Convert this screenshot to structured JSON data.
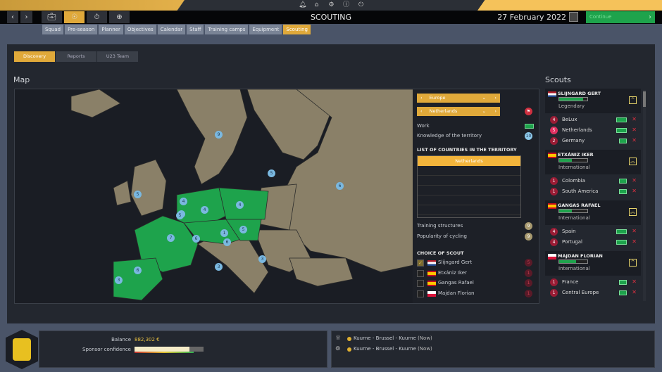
{
  "topbar": {
    "icons": [
      "bell-icon",
      "home-icon",
      "gear-icon",
      "info-icon",
      "power-icon"
    ]
  },
  "nav": {
    "title": "SCOUTING",
    "date": "27 February 2022",
    "continue_label": "Continue"
  },
  "subtabs": [
    "Squad",
    "Pre-season",
    "Planner",
    "Objectives",
    "Calendar",
    "Staff",
    "Training camps",
    "Equipment",
    "Scouting"
  ],
  "active_subtab": "Scouting",
  "tabs": [
    "Discovery",
    "Reports",
    "U23 Team"
  ],
  "map": {
    "heading": "Map",
    "markers": [
      "9",
      "5",
      "4",
      "5",
      "5",
      "7",
      "4",
      "4",
      "1",
      "5",
      "6",
      "6",
      "5",
      "6",
      "3",
      "3",
      "6",
      "3"
    ]
  },
  "territory": {
    "region": "Europe",
    "country": "Netherlands",
    "work_label": "Work",
    "knowledge_label": "Knowledge of the territory",
    "knowledge_value": "10",
    "list_heading": "LIST OF COUNTRIES IN THE TERRITORY",
    "countries": [
      "Netherlands"
    ],
    "training_label": "Training structures",
    "training_value": "9",
    "popularity_label": "Popularity of cycling",
    "popularity_value": "9",
    "choice_heading": "CHOICE OF SCOUT",
    "choices": [
      {
        "name": "Slijngard Gert",
        "checked": true,
        "value": "5"
      },
      {
        "name": "Etxániz Iker",
        "checked": false,
        "value": "1"
      },
      {
        "name": "Gangas Rafael",
        "checked": false,
        "value": "1"
      },
      {
        "name": "Majdan Florian",
        "checked": false,
        "value": "1"
      }
    ]
  },
  "scouts": {
    "heading": "Scouts",
    "list": [
      {
        "name": "SLIJNGARD GERT",
        "rank": "Legendary",
        "level": 0.85,
        "territories": [
          {
            "n": "4",
            "name": "BeLux"
          },
          {
            "n": "5",
            "name": "Netherlands"
          },
          {
            "n": "2",
            "name": "Germany"
          }
        ]
      },
      {
        "name": "ETXÁNIZ IKER",
        "rank": "International",
        "level": 0.45,
        "territories": [
          {
            "n": "1",
            "name": "Colombia"
          },
          {
            "n": "1",
            "name": "South America"
          }
        ]
      },
      {
        "name": "GANGAS RAFAEL",
        "rank": "International",
        "level": 0.45,
        "territories": [
          {
            "n": "4",
            "name": "Spain"
          },
          {
            "n": "4",
            "name": "Portugal"
          }
        ]
      },
      {
        "name": "MAJDAN FLORIAN",
        "rank": "International",
        "level": 0.6,
        "territories": [
          {
            "n": "1",
            "name": "France"
          },
          {
            "n": "1",
            "name": "Central Europe"
          }
        ]
      }
    ]
  },
  "footer": {
    "balance_label": "Balance",
    "balance": "882,302 €",
    "sponsor_label": "Sponsor confidence",
    "sponsor_level": 0.8,
    "races": [
      {
        "icon": "trophy-icon",
        "name": "Kuurne - Brussel - Kuurne",
        "when": "(Now)"
      },
      {
        "icon": "binoculars-icon",
        "name": "Kuurne - Brussel - Kuurne",
        "when": "(Now)"
      }
    ]
  },
  "colors": {
    "accent": "#e0a93a",
    "green": "#1ea34c",
    "land": "#8a8068",
    "highlight": "#1ea34c"
  }
}
